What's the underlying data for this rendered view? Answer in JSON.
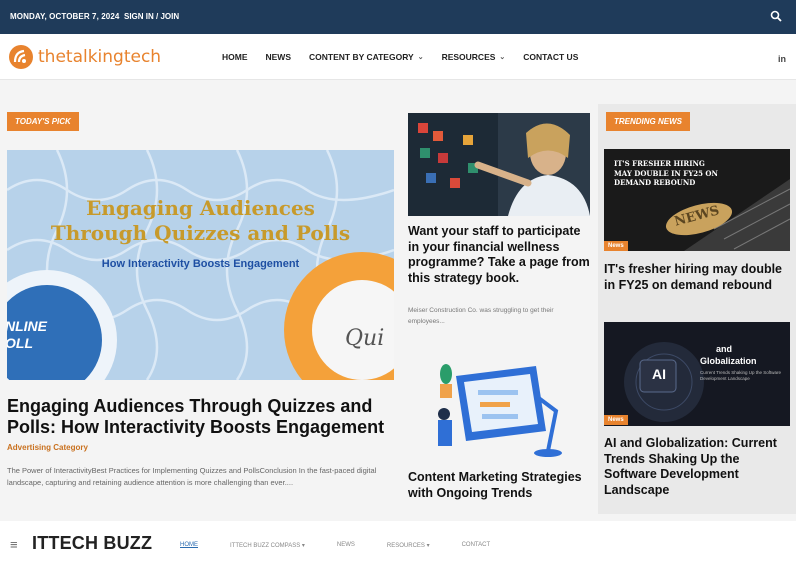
{
  "topbar": {
    "date": "MONDAY, OCTOBER 7, 2024",
    "signin": "SIGN IN / JOIN",
    "search_icon": "search-icon"
  },
  "header": {
    "logo_text": "thetalkingtech",
    "nav": [
      {
        "label": "HOME",
        "has_dropdown": false
      },
      {
        "label": "NEWS",
        "has_dropdown": false
      },
      {
        "label": "CONTENT BY CATEGORY",
        "has_dropdown": true
      },
      {
        "label": "RESOURCES",
        "has_dropdown": true
      },
      {
        "label": "CONTACT US",
        "has_dropdown": false
      }
    ],
    "social": "in"
  },
  "todays_pick": {
    "label": "TODAY'S PICK",
    "image_headline_1": "Engaging Audiences",
    "image_headline_2": "Through Quizzes and Polls",
    "image_subtitle": "How Interactivity Boosts Engagement",
    "image_badge_left": "NLINE\nOLL",
    "image_badge_right": "Qui",
    "title": "Engaging Audiences Through Quizzes and Polls: How Interactivity Boosts Engagement",
    "category": "Advertising Category",
    "excerpt": "The Power of InteractivityBest Practices for Implementing Quizzes and PollsConclusion In the fast-paced digital landscape, capturing and retaining audience attention is more challenging than ever...."
  },
  "middle": {
    "article1_title": "Want your staff to participate in your financial wellness programme? Take a page from this strategy book.",
    "article1_excerpt": "Meiser Construction Co. was struggling to get their employees...",
    "article2_title": "Content Marketing Strategies with Ongoing Trends"
  },
  "trending": {
    "label": "TRENDING NEWS",
    "article1_image_text": "IT'S FRESHER HIRING MAY DOUBLE IN FY25 ON DEMAND REBOUND",
    "article1_image_word": "NEWS",
    "article1_tag": "News",
    "article1_title": "IT's fresher hiring may double in FY25 on demand rebound",
    "article2_image_ai": "AI",
    "article2_image_and": "and",
    "article2_image_glob": "Globalization",
    "article2_image_sub": "Current Trends Shaking Up the Software Development Landscape",
    "article2_tag": "News",
    "article2_title": "AI and Globalization: Current Trends Shaking Up the Software Development Landscape"
  },
  "bottombar": {
    "menu_icon": "≡",
    "logo": "ITTECH BUZZ",
    "nav": [
      {
        "label": "HOME",
        "active": true
      },
      {
        "label": "ITTECH BUZZ COMPASS ▾",
        "active": false
      },
      {
        "label": "NEWS",
        "active": false
      },
      {
        "label": "RESOURCES ▾",
        "active": false
      },
      {
        "label": "CONTACT",
        "active": false
      }
    ]
  },
  "colors": {
    "topbar": "#1f3b5a",
    "accent": "#e8832e",
    "link": "#2b6cb0"
  }
}
